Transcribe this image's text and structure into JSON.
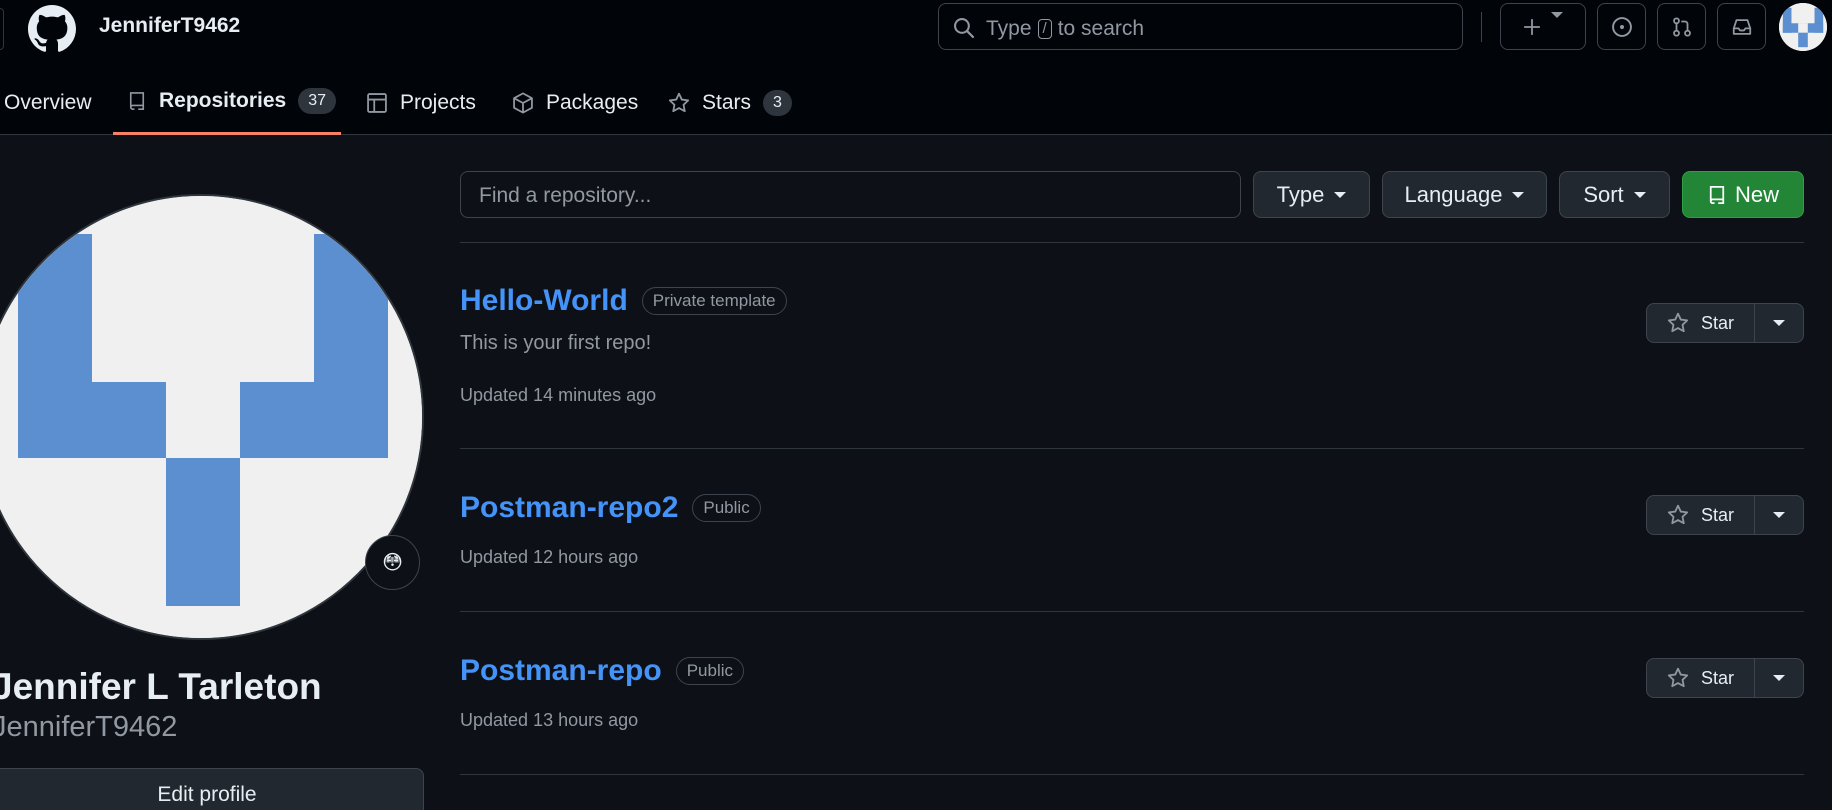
{
  "header": {
    "username": "JenniferT9462",
    "search_prefix": "Type",
    "search_key": "/",
    "search_suffix": "to search",
    "icons": [
      "github-logo-icon",
      "search-icon",
      "plus-icon",
      "chevron-down-icon",
      "issues-icon",
      "pull-requests-icon",
      "inbox-icon"
    ]
  },
  "tabs": [
    {
      "label": "Overview",
      "icon": "book-open-icon"
    },
    {
      "label": "Repositories",
      "icon": "repo-icon",
      "count": "37",
      "active": true
    },
    {
      "label": "Projects",
      "icon": "table-icon"
    },
    {
      "label": "Packages",
      "icon": "package-icon"
    },
    {
      "label": "Stars",
      "icon": "star-icon",
      "count": "3"
    }
  ],
  "profile": {
    "full_name": "Jennifer L Tarleton",
    "login": "JenniferT9462",
    "status_emoji": "😳",
    "edit_label": "Edit profile",
    "avatar_colors": {
      "background": "#f0f0f0",
      "foreground": "#5b8fd0"
    }
  },
  "filters": {
    "find_placeholder": "Find a repository...",
    "type_label": "Type",
    "language_label": "Language",
    "sort_label": "Sort",
    "new_label": "New"
  },
  "repos": [
    {
      "name": "Hello-World",
      "visibility": "Private template",
      "description": "This is your first repo!",
      "updated": "Updated 14 minutes ago",
      "star_label": "Star"
    },
    {
      "name": "Postman-repo2",
      "visibility": "Public",
      "description": "",
      "updated": "Updated 12 hours ago",
      "star_label": "Star"
    },
    {
      "name": "Postman-repo",
      "visibility": "Public",
      "description": "",
      "updated": "Updated 13 hours ago",
      "star_label": "Star"
    }
  ],
  "colors": {
    "accent_link": "#4493f8",
    "active_tab_underline": "#f78166",
    "new_button": "#238636",
    "page_bg": "#0d1117",
    "header_bg": "#010409"
  }
}
